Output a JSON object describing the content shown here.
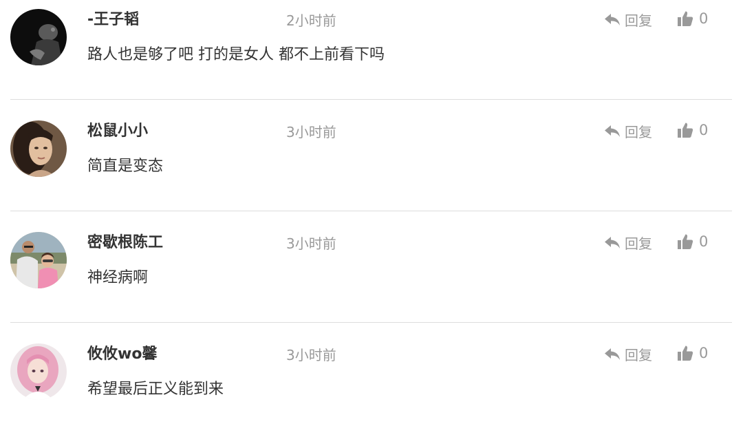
{
  "comments": [
    {
      "username": "-王子韬",
      "time": "2小时前",
      "content": "路人也是够了吧 打的是女人 都不上前看下吗",
      "reply_label": "回复",
      "likes": "0"
    },
    {
      "username": "松鼠小小",
      "time": "3小时前",
      "content": "简直是变态",
      "reply_label": "回复",
      "likes": "0"
    },
    {
      "username": "密歇根陈工",
      "time": "3小时前",
      "content": "神经病啊",
      "reply_label": "回复",
      "likes": "0"
    },
    {
      "username": "攸攸wo馨",
      "time": "3小时前",
      "content": "希望最后正义能到来",
      "reply_label": "回复",
      "likes": "0"
    }
  ],
  "colors": {
    "username": "#333333",
    "meta": "#999999",
    "divider": "#dddddd"
  },
  "icons": {
    "reply": "reply-arrow-icon",
    "like": "thumbs-up-icon"
  }
}
